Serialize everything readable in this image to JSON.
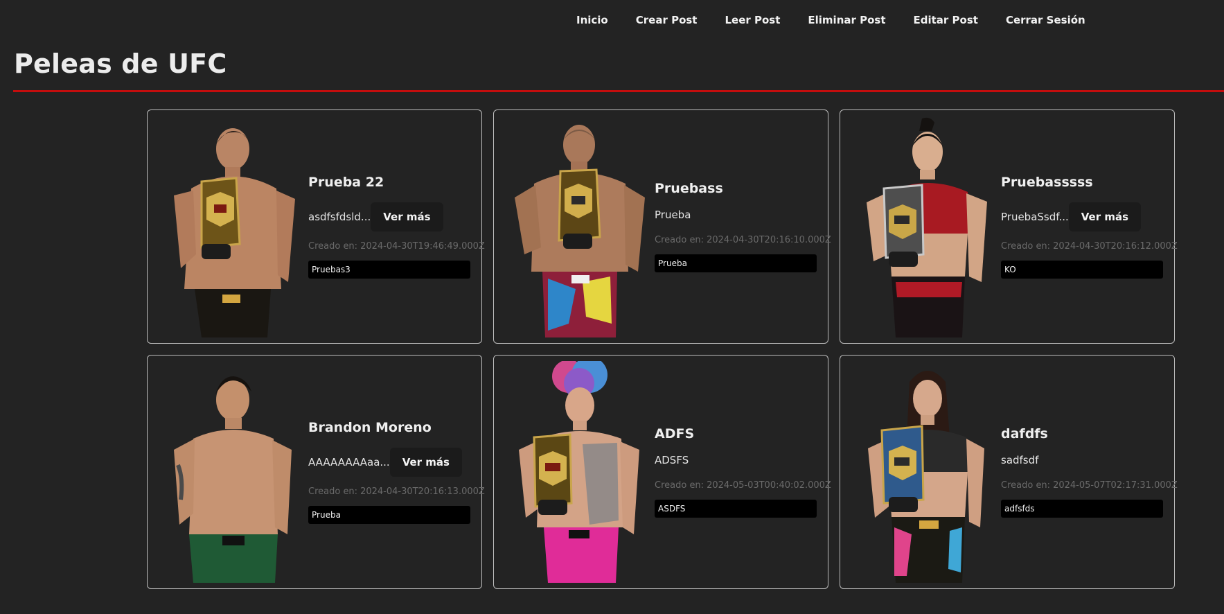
{
  "nav": {
    "items": [
      "Inicio",
      "Crear Post",
      "Leer Post",
      "Eliminar Post",
      "Editar Post",
      "Cerrar Sesión"
    ]
  },
  "page": {
    "title": "Peleas de UFC",
    "accent_color": "#c40d0d"
  },
  "common": {
    "created_prefix": "Creado en:",
    "more_label": "Ver más"
  },
  "posts": [
    {
      "title": "Prueba 22",
      "excerpt": "asdfsfdsld...",
      "has_more": true,
      "created": "2024-04-30T19:46:49.000Z",
      "tag": "Pruebas3",
      "photo_icon": "fighter-with-belt-photo"
    },
    {
      "title": "Pruebass",
      "excerpt": "Prueba",
      "has_more": false,
      "created": "2024-04-30T20:16:10.000Z",
      "tag": "Prueba",
      "photo_icon": "fighter-with-belt-photo"
    },
    {
      "title": "Pruebasssss",
      "excerpt": "PruebaSsdf...",
      "has_more": true,
      "created": "2024-04-30T20:16:12.000Z",
      "tag": "KO",
      "photo_icon": "fighter-with-belt-photo"
    },
    {
      "title": "Brandon Moreno",
      "excerpt": "AAAAAAAAaa...",
      "has_more": true,
      "created": "2024-04-30T20:16:13.000Z",
      "tag": "Prueba",
      "photo_icon": "fighter-photo"
    },
    {
      "title": "ADFS",
      "excerpt": "ADSFS",
      "has_more": false,
      "created": "2024-05-03T00:40:02.000Z",
      "tag": "ASDFS",
      "photo_icon": "fighter-with-belt-photo"
    },
    {
      "title": "dafdfs",
      "excerpt": "sadfsdf",
      "has_more": false,
      "created": "2024-05-07T02:17:31.000Z",
      "tag": "adfsfds",
      "photo_icon": "fighter-with-belt-photo"
    }
  ]
}
